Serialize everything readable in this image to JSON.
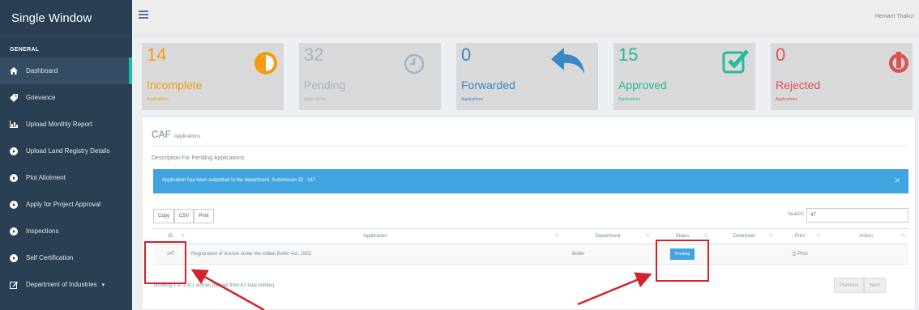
{
  "app": {
    "title": "Single Window",
    "user": "Hemant Thakur"
  },
  "sidebar": {
    "section": "GENERAL",
    "items": [
      {
        "label": "Dashboard",
        "icon": "home-icon",
        "active": true
      },
      {
        "label": "Grievance",
        "icon": "tag-icon"
      },
      {
        "label": "Upload Monthly Report",
        "icon": "bar-chart-icon"
      },
      {
        "label": "Upload Land Registry Details",
        "icon": "circle-icon"
      },
      {
        "label": "Plot Allotment",
        "icon": "circle-icon"
      },
      {
        "label": "Apply for Project Approval",
        "icon": "circle-icon"
      },
      {
        "label": "Inspections",
        "icon": "circle-icon"
      },
      {
        "label": "Self Certification",
        "icon": "circle-icon"
      },
      {
        "label": "Department of Industries",
        "icon": "edit-icon"
      }
    ]
  },
  "stats": [
    {
      "count": "14",
      "label": "Incomplete",
      "sub": "Applications",
      "color": "#f39c12",
      "icon": "half-circle-icon"
    },
    {
      "count": "32",
      "label": "Pending",
      "sub": "Applications",
      "color": "#a4b3c4",
      "icon": "clock-icon"
    },
    {
      "count": "0",
      "label": "Forwarded",
      "sub": "Applications",
      "color": "#3a87c8",
      "icon": "reply-arrow-icon"
    },
    {
      "count": "15",
      "label": "Approved",
      "sub": "Applications",
      "color": "#26b99a",
      "icon": "check-square-icon"
    },
    {
      "count": "0",
      "label": "Rejected",
      "sub": "Applications",
      "color": "#d9534f",
      "icon": "power-icon"
    }
  ],
  "panel": {
    "title": "CAF",
    "subtitle": "Applications",
    "description": "Description For Pending Applications",
    "alert": "Application has been submitted to the department. Submission ID : 147",
    "alert_close": "×",
    "buttons": [
      "Copy",
      "CSV",
      "Print"
    ],
    "search_label": "Search:",
    "search_value": "47",
    "table": {
      "headers": [
        "ID",
        "Application",
        "Department",
        "Status",
        "Download",
        "Print",
        "Action"
      ],
      "rows": [
        {
          "id": "147",
          "application": "Registration of license under the Indian Boiler Act, 1923",
          "department": "Boiler",
          "status": "Pending",
          "download": "",
          "print": "Print",
          "action": ""
        }
      ]
    },
    "info": "Showing 1 to 1 of 1 entries (filtered from 61 total entries)",
    "pager": {
      "prev": "Previous",
      "next": "Next"
    }
  }
}
